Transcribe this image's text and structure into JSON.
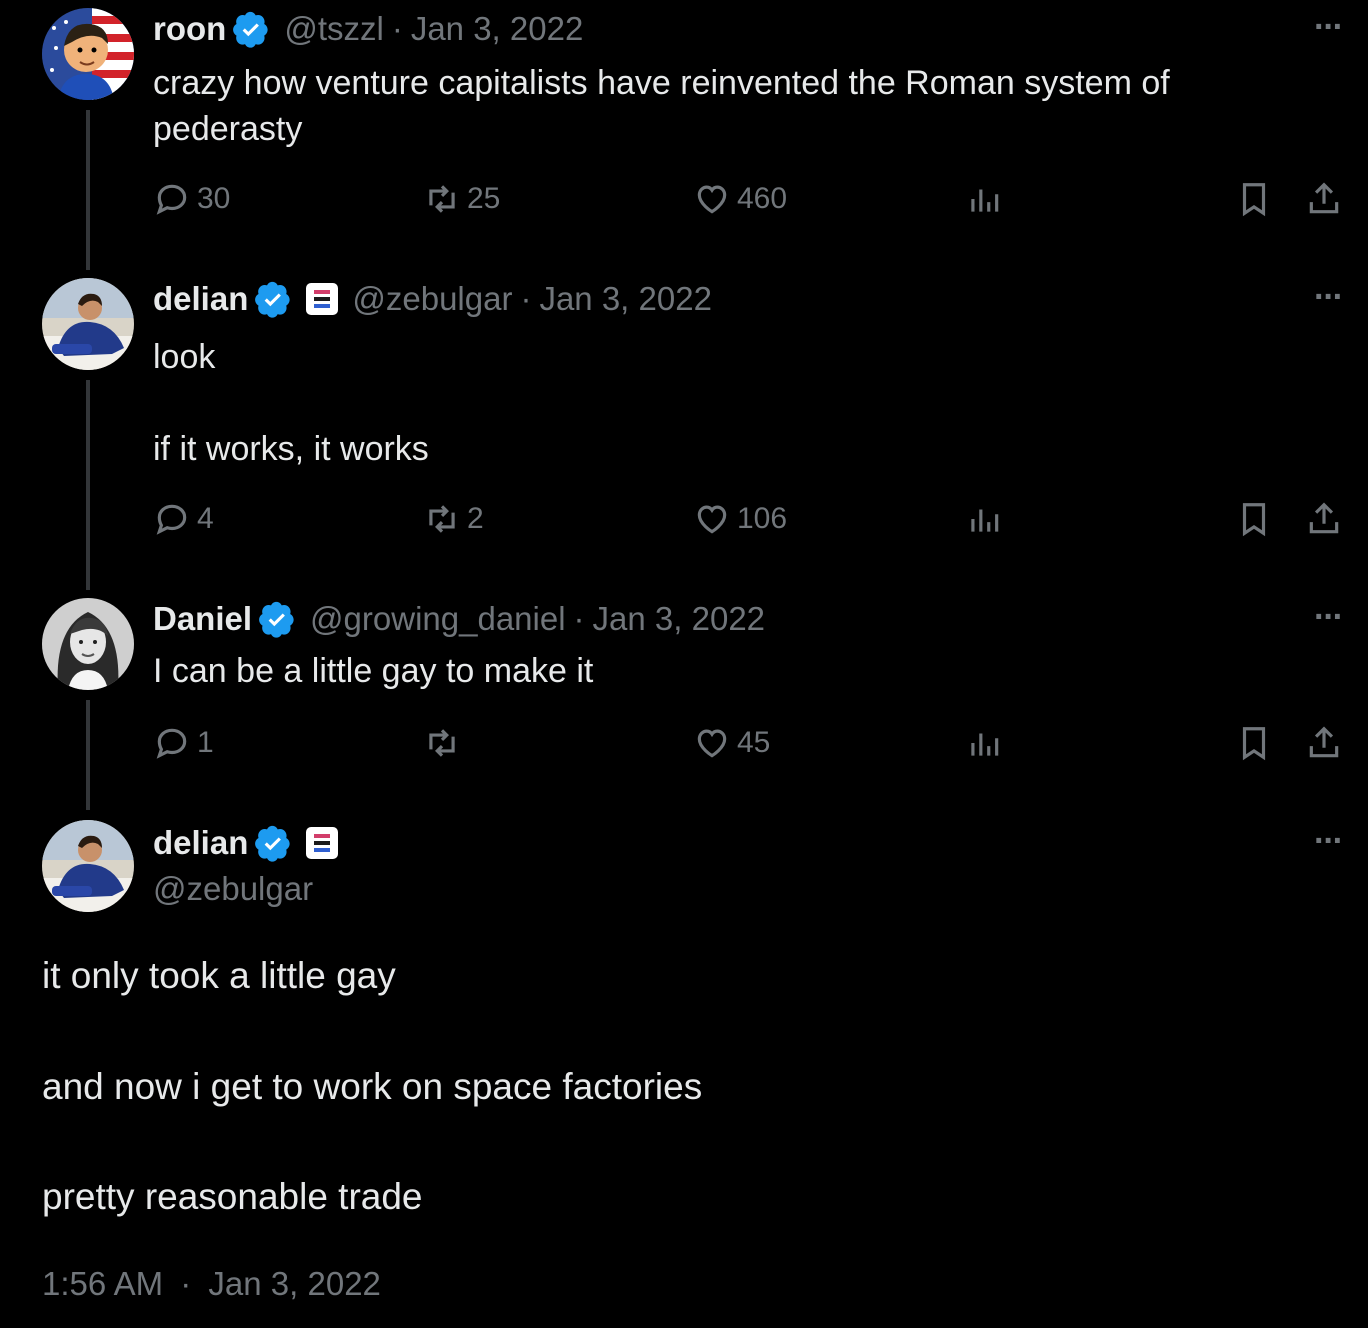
{
  "tweets": [
    {
      "name": "roon",
      "handle": "@tszzl",
      "date": "Jan 3, 2022",
      "text": "crazy how venture capitalists have reinvented the Roman system of pederasty",
      "replies": "30",
      "retweets": "25",
      "likes": "460"
    },
    {
      "name": "delian",
      "handle": "@zebulgar",
      "date": "Jan 3, 2022",
      "text_line1": "look",
      "text_line2": "if it works, it works",
      "replies": "4",
      "retweets": "2",
      "likes": "106"
    },
    {
      "name": "Daniel",
      "handle": "@growing_daniel",
      "date": "Jan 3, 2022",
      "text": "I can be a little gay to make it",
      "replies": "1",
      "retweets": "",
      "likes": "45"
    }
  ],
  "main": {
    "name": "delian",
    "handle": "@zebulgar",
    "line1": "it only took a little gay",
    "line2": "and now i get to work on space factories",
    "line3": "pretty reasonable trade",
    "time": "1:56 AM",
    "date": "Jan 3, 2022"
  },
  "separator": "·",
  "more_glyph": "···",
  "colors": {
    "background": "#000000",
    "text": "#e7e9ea",
    "muted": "#71767b",
    "verified": "#1d9bf0"
  },
  "icons": [
    "reply-icon",
    "retweet-icon",
    "like-icon",
    "views-icon",
    "bookmark-icon",
    "share-icon",
    "verified-badge-icon",
    "more-icon"
  ]
}
